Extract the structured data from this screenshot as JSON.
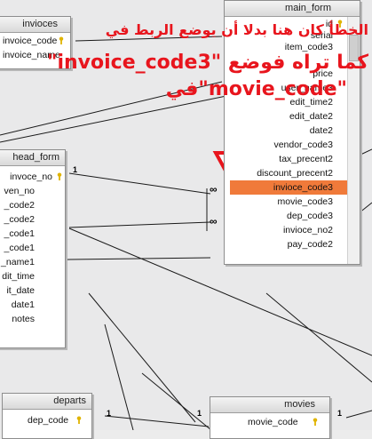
{
  "tables": {
    "invioces": {
      "title": "invioces",
      "fields": [
        "invoice_code",
        "invoice_name"
      ]
    },
    "main_form": {
      "title": "main_form",
      "fields": [
        "id",
        "serial",
        "item_code3",
        "price",
        "user_name3",
        "edit_time2",
        "edit_date2",
        "date2",
        "vendor_code3",
        "tax_precent2",
        "discount_precent2",
        "invioce_code3",
        "movie_code3",
        "dep_code3",
        "invioce_no2",
        "pay_code2"
      ],
      "highlighted": "invioce_code3"
    },
    "head_form": {
      "title": "head_form",
      "fields": [
        "invoce_no",
        "ven_no",
        "_code2",
        "_code2",
        "_code1",
        "_code1",
        "_name1",
        "dit_time",
        "it_date",
        "date1",
        "notes"
      ]
    },
    "departs": {
      "title": "departs",
      "fields": [
        "dep_code"
      ]
    },
    "movies": {
      "title": "movies",
      "fields": [
        "movie_code"
      ]
    }
  },
  "annotation": {
    "line1": "الخطأ كان هنا بدلا أن يوضع الربط في",
    "line2": "\"invoice_code3\" كما تراه فوضع",
    "line3": "في\"movie_code\""
  },
  "cardinality": {
    "one": "1",
    "many": "∞"
  },
  "colors": {
    "highlight": "#f07a3a",
    "annotation": "#e8151d",
    "key": "#e0b400"
  },
  "icons": [
    "key-icon",
    "down-arrow-icon"
  ]
}
